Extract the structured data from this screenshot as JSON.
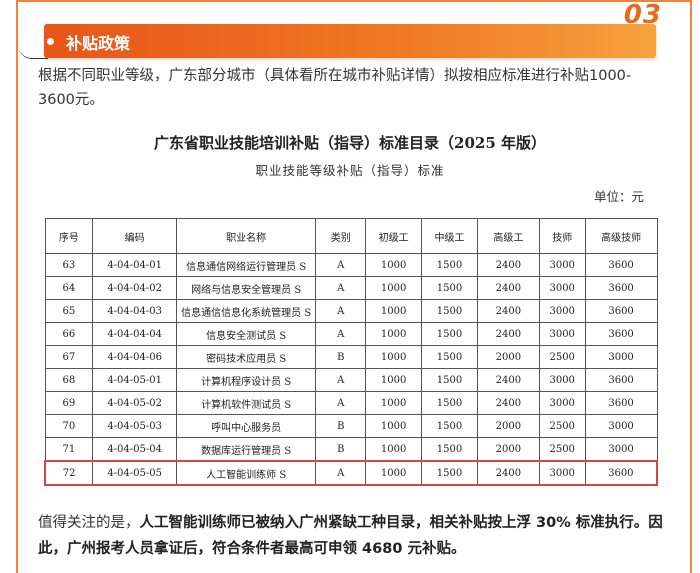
{
  "section": {
    "number": "03",
    "title": "补贴政策"
  },
  "intro_text": "根据不同职业等级，广东部分城市（具体看所在城市补贴详情）拟按相应标准进行补贴1000-3600元。",
  "table": {
    "title": "广东省职业技能培训补贴（指导）标准目录（2025 年版）",
    "subtitle": "职业技能等级补贴（指导）标准",
    "unit": "单位：元",
    "headers": [
      "序号",
      "编码",
      "职业名称",
      "类别",
      "初级工",
      "中级工",
      "高级工",
      "技师",
      "高级技师"
    ],
    "rows": [
      [
        "63",
        "4-04-04-01",
        "信息通信网络运行管理员 S",
        "A",
        "1000",
        "1500",
        "2400",
        "3000",
        "3600"
      ],
      [
        "64",
        "4-04-04-02",
        "网络与信息安全管理员 S",
        "A",
        "1000",
        "1500",
        "2400",
        "3000",
        "3600"
      ],
      [
        "65",
        "4-04-04-03",
        "信息通信信息化系统管理员 S",
        "A",
        "1000",
        "1500",
        "2400",
        "3000",
        "3600"
      ],
      [
        "66",
        "4-04-04-04",
        "信息安全测试员 S",
        "A",
        "1000",
        "1500",
        "2400",
        "3000",
        "3600"
      ],
      [
        "67",
        "4-04-04-06",
        "密码技术应用员 S",
        "B",
        "1000",
        "1500",
        "2000",
        "2500",
        "3000"
      ],
      [
        "68",
        "4-04-05-01",
        "计算机程序设计员 S",
        "A",
        "1000",
        "1500",
        "2400",
        "3000",
        "3600"
      ],
      [
        "69",
        "4-04-05-02",
        "计算机软件测试员 S",
        "A",
        "1000",
        "1500",
        "2400",
        "3000",
        "3600"
      ],
      [
        "70",
        "4-04-05-03",
        "呼叫中心服务员",
        "B",
        "1000",
        "1500",
        "2000",
        "2500",
        "3000"
      ],
      [
        "71",
        "4-04-05-04",
        "数据库运行管理员 S",
        "B",
        "1000",
        "1500",
        "2000",
        "2500",
        "3000"
      ],
      [
        "72",
        "4-04-05-05",
        "人工智能训练师 S",
        "A",
        "1000",
        "1500",
        "2400",
        "3000",
        "3600"
      ]
    ],
    "highlight_row": 9
  },
  "note": {
    "lead": "值得关注的是，",
    "bold": "人工智能训练师已被纳入广州紧缺工种目录，相关补贴按上浮 30% 标准执行。因此，广州报考人员拿证后，符合条件者最高可申领 4680 元补贴。"
  },
  "colors": {
    "accent": "#f0843c",
    "highlight_border": "#d9443b"
  }
}
